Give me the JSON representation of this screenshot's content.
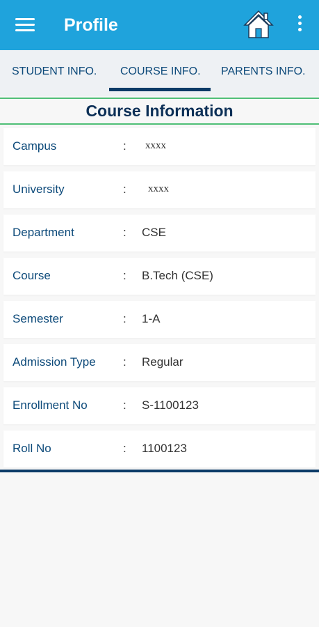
{
  "appbar": {
    "title": "Profile",
    "icons": {
      "menu": "hamburger-menu-icon",
      "home": "home-icon",
      "more": "more-vert-icon"
    }
  },
  "tabs": [
    {
      "label": "STUDENT INFO.",
      "selected": false
    },
    {
      "label": "COURSE INFO.",
      "selected": true
    },
    {
      "label": "PARENTS INFO.",
      "selected": false
    }
  ],
  "section": {
    "title": "Course Information"
  },
  "rows": [
    {
      "label": "Campus",
      "colon": ":",
      "value": "xxxx"
    },
    {
      "label": "University",
      "colon": ":",
      "value": "xxxx"
    },
    {
      "label": "Department",
      "colon": ":",
      "value": "CSE"
    },
    {
      "label": "Course",
      "colon": ":",
      "value": "B.Tech (CSE)"
    },
    {
      "label": "Semester",
      "colon": ":",
      "value": "1-A"
    },
    {
      "label": "Admission Type",
      "colon": ":",
      "value": "Regular"
    },
    {
      "label": "Enrollment No",
      "colon": ":",
      "value": "S-1100123"
    },
    {
      "label": "Roll No",
      "colon": ":",
      "value": "1100123"
    }
  ],
  "colors": {
    "appbar": "#1fa3dc",
    "accent": "#0c3b67",
    "divider": "#4fbf77",
    "label": "#0d4a7a"
  }
}
